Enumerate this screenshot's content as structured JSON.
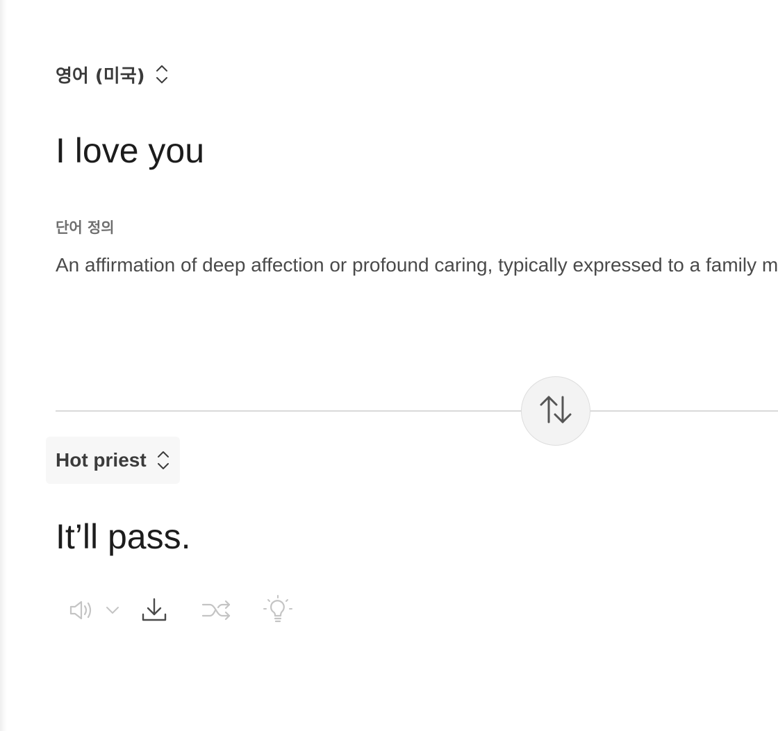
{
  "source": {
    "language_label": "영어 (미국)",
    "text": "I love you",
    "definition_heading": "단어 정의",
    "definition_text": "An affirmation of deep affection or profound caring, typically expressed to a family member, partner, or close friend."
  },
  "target": {
    "language_label": "Hot priest",
    "text": "It’ll pass."
  },
  "icons": {
    "selector": "chevron-up-down-icon",
    "swap": "swap-vertical-arrows-icon",
    "speaker": "speaker-icon",
    "speaker_menu": "chevron-down-icon",
    "download": "download-icon",
    "shuffle": "shuffle-icon",
    "idea": "lightbulb-icon"
  },
  "colors": {
    "text_primary": "#1c1c1c",
    "text_secondary": "#6e6e6e",
    "icon_disabled": "#c4c4c4",
    "icon_active": "#4a4a4a"
  }
}
